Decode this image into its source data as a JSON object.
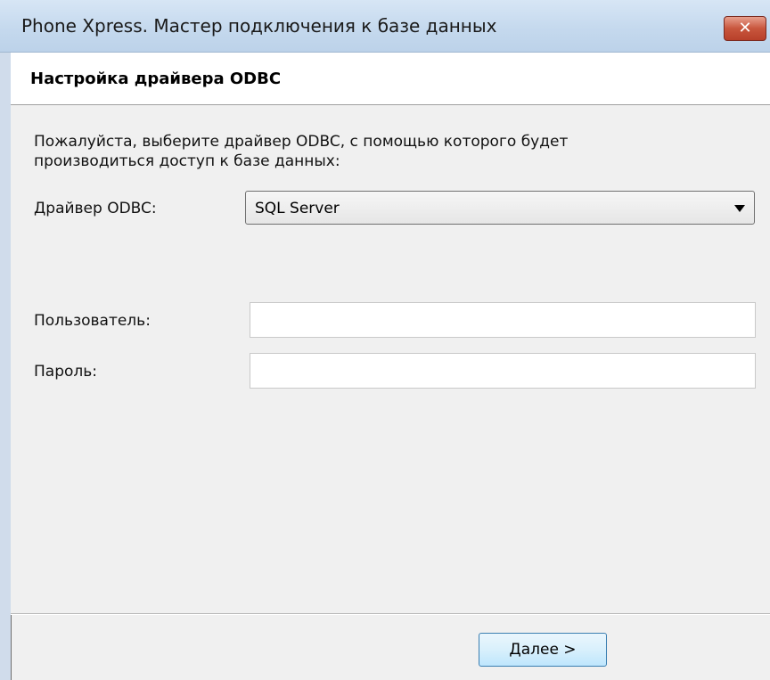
{
  "window": {
    "title": "Phone Xpress. Мастер подключения к базе данных",
    "close_icon": "close-icon",
    "close_glyph": "✕"
  },
  "header": {
    "title": "Настройка драйвера ODBC"
  },
  "main": {
    "instruction": "Пожалуйста, выберите драйвер ODBC, с помощью которого будет производиться доступ к базе данных:",
    "driver_label": "Драйвер ODBC:",
    "driver_value": "SQL Server",
    "user_label": "Пользователь:",
    "user_value": "",
    "password_label": "Пароль:",
    "password_value": ""
  },
  "footer": {
    "next_label": "Далее >"
  },
  "colors": {
    "accent": "#3c7fb1",
    "close_button": "#c8563d"
  }
}
